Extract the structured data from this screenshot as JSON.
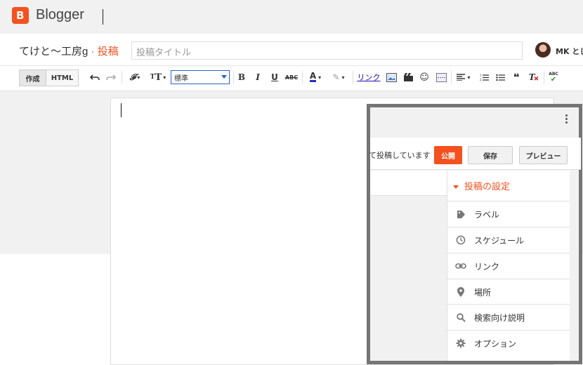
{
  "header": {
    "brand": "Blogger",
    "logo_letter": "B"
  },
  "titlebar": {
    "blog_name": "てけと〜工房g",
    "separator": "·",
    "section": "投稿",
    "title_placeholder": "投稿タイトル",
    "user_name": "MK とし"
  },
  "toolbar": {
    "compose": "作成",
    "html": "HTML",
    "font_size": "標準",
    "link": "リンク",
    "spellcheck": "ABC"
  },
  "panel": {
    "status": "て投稿しています",
    "publish": "公開",
    "save": "保存",
    "preview": "プレビュー",
    "settings_title": "投稿の設定",
    "items": [
      {
        "label": "ラベル",
        "icon": "label-icon"
      },
      {
        "label": "スケジュール",
        "icon": "clock-icon"
      },
      {
        "label": "リンク",
        "icon": "link-icon"
      },
      {
        "label": "場所",
        "icon": "pin-icon"
      },
      {
        "label": "検索向け説明",
        "icon": "search-icon"
      },
      {
        "label": "オプション",
        "icon": "gear-icon"
      }
    ]
  },
  "colors": {
    "accent": "#f4511e",
    "frame": "#757575"
  }
}
